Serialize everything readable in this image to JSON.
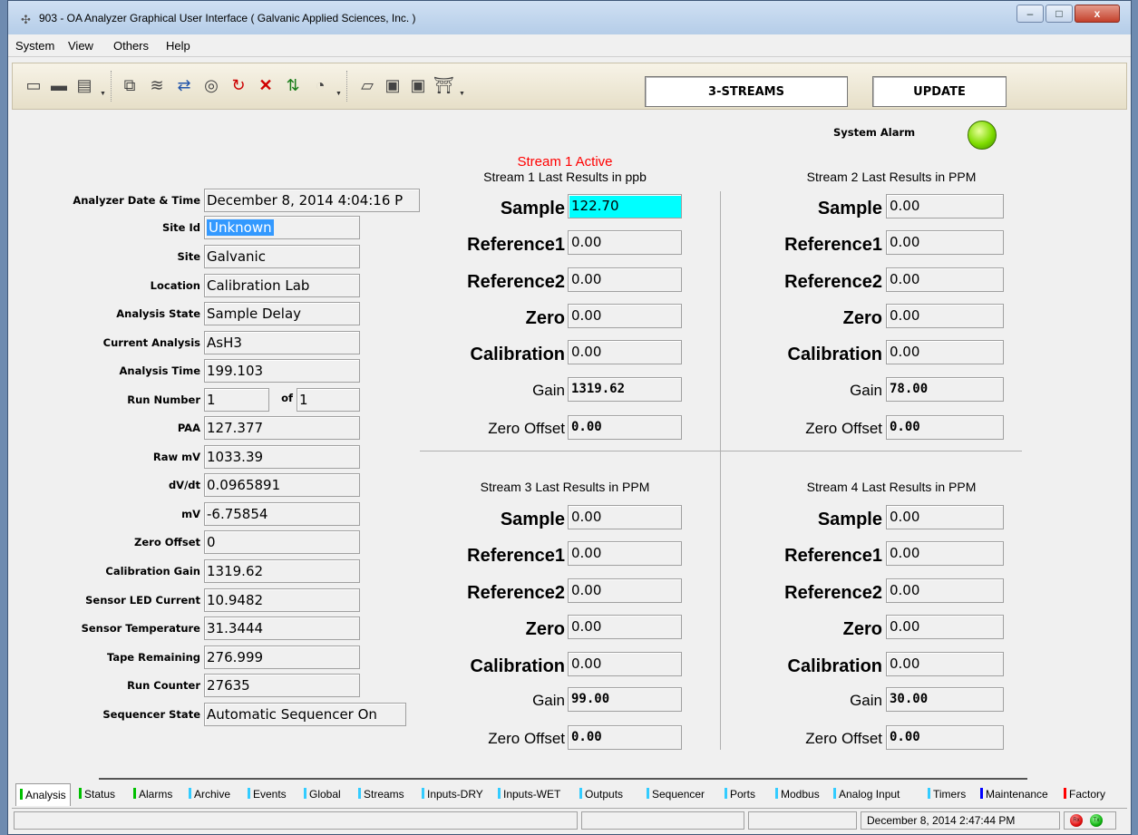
{
  "window": {
    "title": "903 - OA Analyzer Graphical User Interface  ( Galvanic Applied Sciences, Inc. )",
    "minimize": "–",
    "maximize": "□",
    "close": "x"
  },
  "menu": {
    "system": "System",
    "view": "View",
    "others": "Others",
    "help": "Help"
  },
  "toolbar": {
    "mode": "3-STREAMS",
    "update": "UPDATE"
  },
  "alarm": {
    "label": "System Alarm",
    "color": "#7fdc00"
  },
  "left": {
    "date_label": "Analyzer Date & Time",
    "date_value": "December 8, 2014 4:04:16 P",
    "siteid_label": "Site Id",
    "siteid_value": "Unknown",
    "site_label": "Site",
    "site_value": "Galvanic",
    "location_label": "Location",
    "location_value": "Calibration Lab",
    "state_label": "Analysis State",
    "state_value": "Sample Delay",
    "current_label": "Current Analysis",
    "current_value": "AsH3",
    "time_label": "Analysis Time",
    "time_value": "199.103",
    "run_label": "Run Number",
    "run_value": "1",
    "of_label": "of",
    "of_value": "1",
    "paa_label": "PAA",
    "paa_value": "127.377",
    "rawmv_label": "Raw mV",
    "rawmv_value": "1033.39",
    "dvdt_label": "dV/dt",
    "dvdt_value": "0.0965891",
    "mv_label": "mV",
    "mv_value": "-6.75854",
    "zero_label": "Zero Offset",
    "zero_value": "0",
    "calgain_label": "Calibration Gain",
    "calgain_value": "1319.62",
    "led_label": "Sensor LED Current",
    "led_value": "10.9482",
    "temp_label": "Sensor Temperature",
    "temp_value": "31.3444",
    "tape_label": "Tape Remaining",
    "tape_value": "276.999",
    "counter_label": "Run Counter",
    "counter_value": "27635",
    "seq_label": "Sequencer State",
    "seq_value": "Automatic Sequencer On"
  },
  "labels": {
    "sample": "Sample",
    "ref1": "Reference1",
    "ref2": "Reference2",
    "zero": "Zero",
    "calibration": "Calibration",
    "gain": "Gain",
    "zero_offset": "Zero Offset"
  },
  "stream1_active": "Stream 1 Active",
  "streams": [
    {
      "title": "Stream 1 Last Results in  ppb",
      "sample": "122.70",
      "ref1": "0.00",
      "ref2": "0.00",
      "zero": "0.00",
      "calibration": "0.00",
      "gain": "1319.62",
      "zero_offset": "0.00"
    },
    {
      "title": "Stream 2 Last Results in PPM",
      "sample": "0.00",
      "ref1": "0.00",
      "ref2": "0.00",
      "zero": "0.00",
      "calibration": "0.00",
      "gain": "78.00",
      "zero_offset": "0.00"
    },
    {
      "title": "Stream 3 Last Results in PPM",
      "sample": "0.00",
      "ref1": "0.00",
      "ref2": "0.00",
      "zero": "0.00",
      "calibration": "0.00",
      "gain": "99.00",
      "zero_offset": "0.00"
    },
    {
      "title": "Stream 4 Last Results in PPM",
      "sample": "0.00",
      "ref1": "0.00",
      "ref2": "0.00",
      "zero": "0.00",
      "calibration": "0.00",
      "gain": "30.00",
      "zero_offset": "0.00"
    }
  ],
  "tabs": [
    {
      "label": "Analysis",
      "color": "#00c000"
    },
    {
      "label": "Status",
      "color": "#00c000"
    },
    {
      "label": "Alarms",
      "color": "#00c000"
    },
    {
      "label": "Archive",
      "color": "#33ccff"
    },
    {
      "label": "Events",
      "color": "#33ccff"
    },
    {
      "label": "Global",
      "color": "#33ccff"
    },
    {
      "label": "Streams",
      "color": "#33ccff"
    },
    {
      "label": "Inputs-DRY",
      "color": "#33ccff"
    },
    {
      "label": "Inputs-WET",
      "color": "#33ccff"
    },
    {
      "label": "Outputs",
      "color": "#33ccff"
    },
    {
      "label": "Sequencer",
      "color": "#33ccff"
    },
    {
      "label": "Ports",
      "color": "#33ccff"
    },
    {
      "label": "Modbus",
      "color": "#33ccff"
    },
    {
      "label": "Analog Input",
      "color": "#33ccff"
    },
    {
      "label": "Timers",
      "color": "#33ccff"
    },
    {
      "label": "Maintenance",
      "color": "#0000ff"
    },
    {
      "label": "Factory",
      "color": "#ff0000"
    }
  ],
  "status": {
    "datetime": "December 8, 2014 2:47:44 PM",
    "rx": "Rx",
    "tx": "Tx"
  },
  "icons": [
    "printer-icon",
    "printer-setup-icon",
    "device-icon",
    "connect-icon",
    "scan-icon",
    "transfer-icon",
    "gauge-icon",
    "redo-icon",
    "cancel-icon",
    "traffic-light-icon",
    "chart-icon",
    "open-folder-icon",
    "save-icon",
    "save-as-icon",
    "exit-icon"
  ]
}
